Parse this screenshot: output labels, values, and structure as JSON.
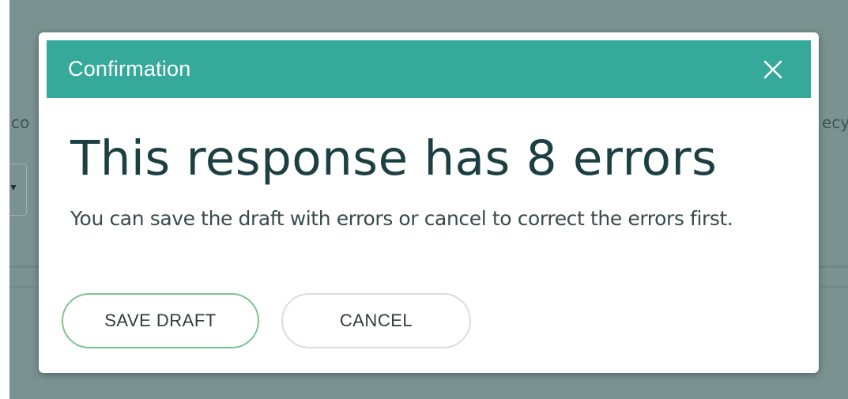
{
  "background": {
    "left_fragment": "co",
    "right_fragment": "ecy"
  },
  "dialog": {
    "title": "Confirmation",
    "heading": "This response has 8 errors",
    "message": "You can save the draft with errors or cancel to correct the errors first.",
    "buttons": {
      "save_draft": "SAVE DRAFT",
      "cancel": "CANCEL"
    },
    "close_icon": "close-icon"
  },
  "colors": {
    "header": "#35a99a",
    "heading_text": "#1c3f42",
    "save_border": "#7cc48b",
    "backdrop": "#7a9391"
  }
}
